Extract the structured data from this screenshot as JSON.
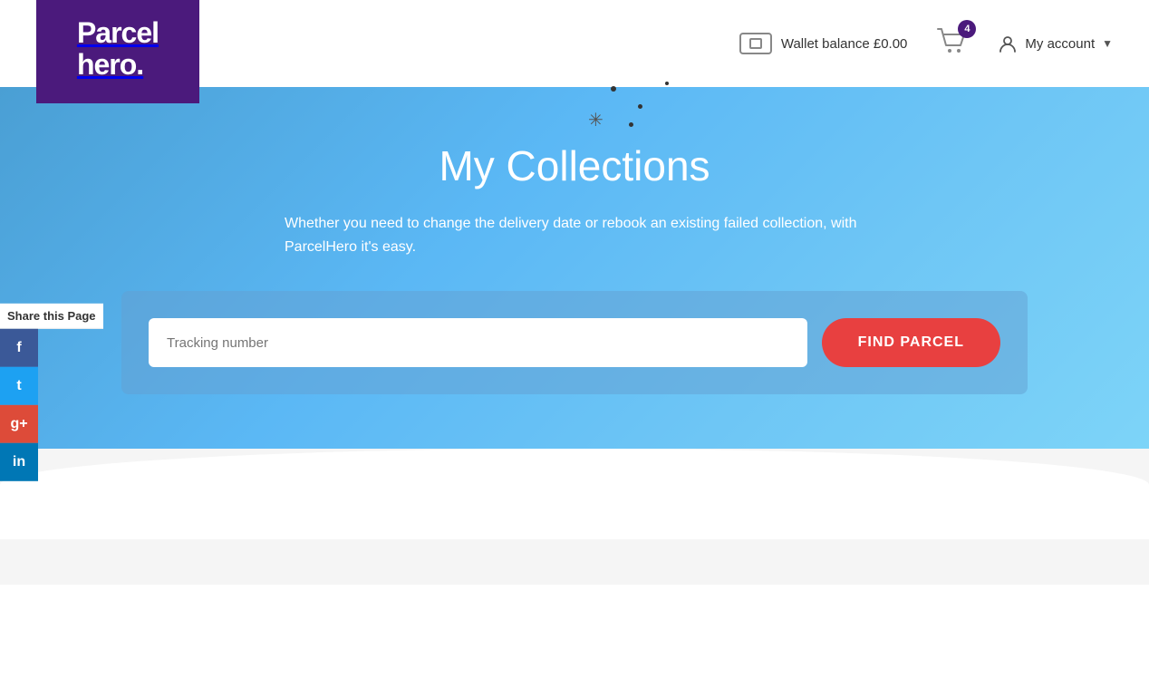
{
  "header": {
    "logo_line1": "Parcel",
    "logo_line2": "hero.",
    "wallet_label": "Wallet balance £0.00",
    "cart_count": "4",
    "account_label": "My account"
  },
  "share": {
    "label": "Share this Page",
    "facebook": "f",
    "twitter": "t",
    "google": "g+",
    "linkedin": "in"
  },
  "hero": {
    "title": "My Collections",
    "subtitle": "Whether you need to change the delivery date or rebook an existing failed collection, with ParcelHero it's easy.",
    "input_placeholder": "Tracking number",
    "button_label": "FIND PARCEL"
  }
}
